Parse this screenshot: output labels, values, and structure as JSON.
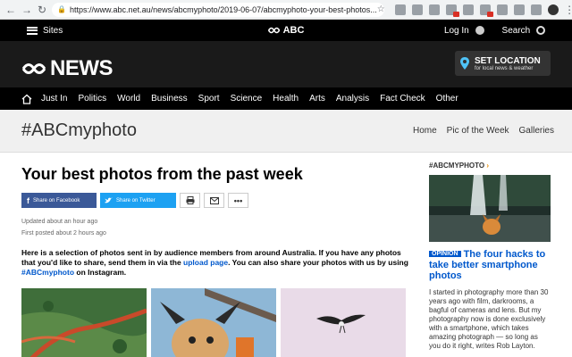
{
  "browser": {
    "url": "https://www.abc.net.au/news/abcmyphoto/2019-06-07/abcmyphoto-your-best-photos..."
  },
  "abc_bar": {
    "sites_label": "Sites",
    "brand": "ABC",
    "login_label": "Log In",
    "search_label": "Search"
  },
  "news_header": {
    "logo_text": "NEWS",
    "set_location_title": "SET LOCATION",
    "set_location_sub": "for local news & weather"
  },
  "main_nav": {
    "items": [
      "Just In",
      "Politics",
      "World",
      "Business",
      "Sport",
      "Science",
      "Health",
      "Arts",
      "Analysis",
      "Fact Check",
      "Other"
    ]
  },
  "section": {
    "title": "#ABCmyphoto",
    "links": [
      "Home",
      "Pic of the Week",
      "Galleries"
    ]
  },
  "article": {
    "headline": "Your best photos from the past week",
    "share_facebook": "Share on Facebook",
    "share_twitter": "Share on Twitter",
    "updated": "Updated about an hour ago",
    "first_posted": "First posted about 2 hours ago",
    "intro_1": "Here is a selection of photos sent in by audience members from around Australia. If you have any photos that you'd like to share, send them in via the ",
    "intro_link_1": "upload page",
    "intro_2": ". You can also share your photos with us by using ",
    "intro_link_2": "#ABCmyphoto",
    "intro_3": " on Instagram."
  },
  "sidebar": {
    "tag": "#ABCMYPHOTO",
    "tag_arrow": "›",
    "opinion_badge": "OPINION",
    "headline": "The four hacks to take better smartphone photos",
    "body": "I started in photography more than 30 years ago with film, darkrooms, a bagful of cameras and lens. But my photography now is done exclusively with a smartphone, which takes amazing photograph — so long as you do it right, writes Rob Layton."
  },
  "colors": {
    "abc_black": "#000000",
    "link_blue": "#0058cc",
    "facebook": "#3b5998",
    "twitter": "#1da1f2"
  }
}
